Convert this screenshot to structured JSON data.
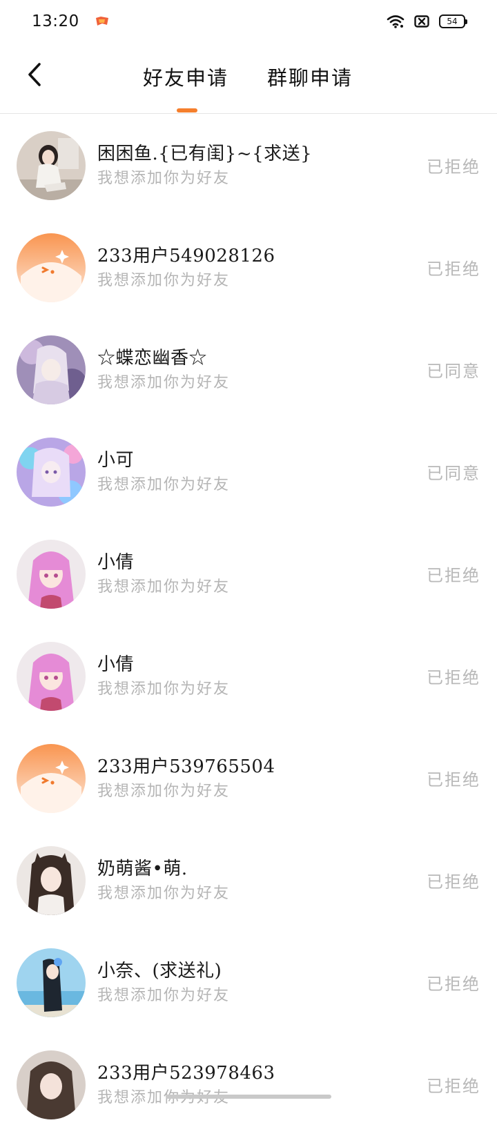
{
  "status_bar": {
    "time": "13:20",
    "battery": "54"
  },
  "header": {
    "tabs": [
      {
        "label": "好友申请",
        "active": true
      },
      {
        "label": "群聊申请",
        "active": false
      }
    ],
    "accent_color": "#f57f2d"
  },
  "requests": [
    {
      "name": "困困鱼.{已有闺}~{求送}",
      "message": "我想添加你为好友",
      "status": "已拒绝",
      "avatar": "photo-girl-room"
    },
    {
      "name": "233用户549028126",
      "message": "我想添加你为好友",
      "status": "已拒绝",
      "avatar": "default-orange-mascot"
    },
    {
      "name": "☆蝶恋幽香☆",
      "message": "我想添加你为好友",
      "status": "已同意",
      "avatar": "anime-girl-lavender"
    },
    {
      "name": "小可",
      "message": "我想添加你为好友",
      "status": "已同意",
      "avatar": "anime-girl-colorful"
    },
    {
      "name": "小倩",
      "message": "我想添加你为好友",
      "status": "已拒绝",
      "avatar": "anime-girl-pink-hair"
    },
    {
      "name": "小倩",
      "message": "我想添加你为好友",
      "status": "已拒绝",
      "avatar": "anime-girl-pink-hair"
    },
    {
      "name": "233用户539765504",
      "message": "我想添加你为好友",
      "status": "已拒绝",
      "avatar": "default-orange-mascot"
    },
    {
      "name": "奶萌酱•萌.",
      "message": "我想添加你为好友",
      "status": "已拒绝",
      "avatar": "photo-girl-cat-ears"
    },
    {
      "name": "小奈、(求送礼)",
      "message": "我想添加你为好友",
      "status": "已拒绝",
      "avatar": "photo-girl-beach"
    },
    {
      "name": "233用户523978463",
      "message": "我想添加你为好友",
      "status": "已拒绝",
      "avatar": "photo-girl-portrait"
    }
  ]
}
